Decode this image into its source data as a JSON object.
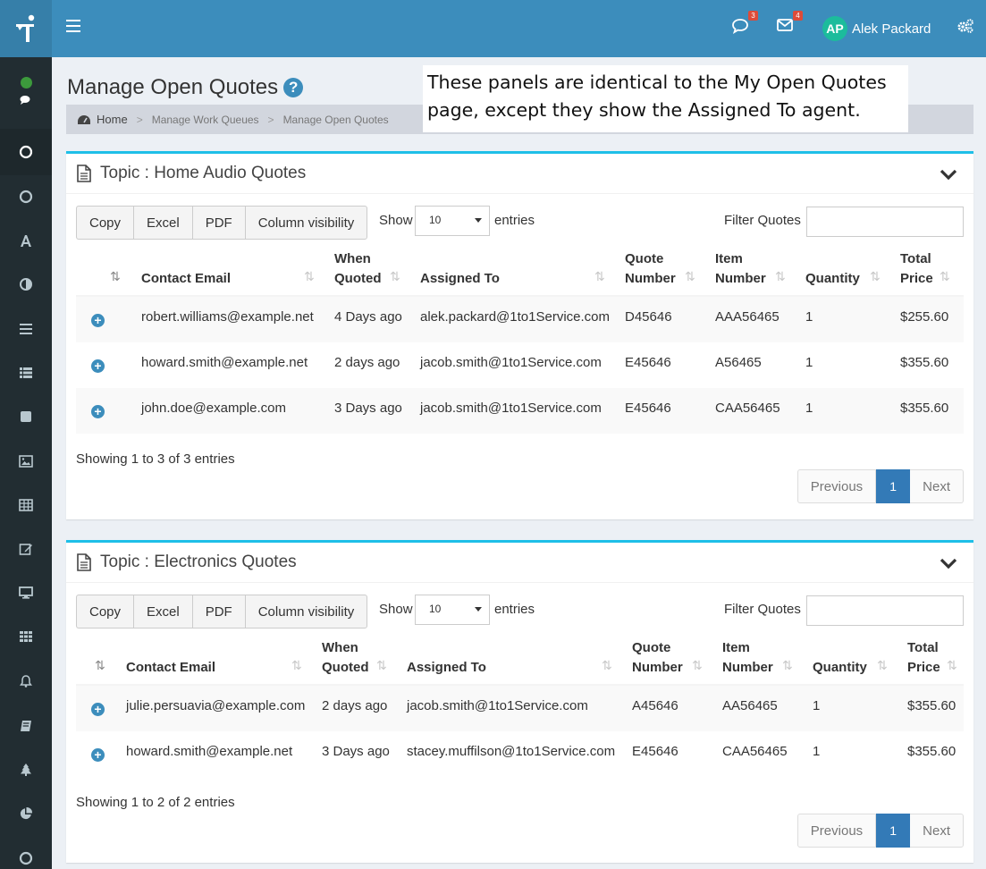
{
  "header": {
    "user_initials": "AP",
    "user_name": "Alek Packard",
    "chat_badge": "3",
    "mail_badge": "4"
  },
  "page": {
    "title": "Manage Open Quotes",
    "help": "?",
    "breadcrumb": [
      "Home",
      "Manage Work Queues",
      "Manage Open Quotes"
    ],
    "callout": [
      "These panels are identical to the My Open Quotes",
      "page, except they show the Assigned To agent."
    ]
  },
  "toolbar": {
    "copy": "Copy",
    "excel": "Excel",
    "pdf": "PDF",
    "column_visibility": "Column visibility",
    "show": "Show",
    "entries_value": "10",
    "entries": "entries",
    "filter": "Filter Quotes"
  },
  "columns": {
    "email": "Contact Email",
    "when1": "When",
    "when2": "Quoted",
    "assigned": "Assigned To",
    "quote1": "Quote",
    "quote2": "Number",
    "item1": "Item",
    "item2": "Number",
    "qty": "Quantity",
    "total1": "Total",
    "total2": "Price"
  },
  "pager": {
    "previous": "Previous",
    "page": "1",
    "next": "Next"
  },
  "panels": [
    {
      "title": "Topic : Home Audio Quotes",
      "info": "Showing 1 to 3 of 3 entries",
      "rows": [
        [
          "robert.williams@example.net",
          "4 Days ago",
          "alek.packard@1to1Service.com",
          "D45646",
          "AAA56465",
          "1",
          "$255.60"
        ],
        [
          "howard.smith@example.net",
          "2 days ago",
          "jacob.smith@1to1Service.com",
          "E45646",
          "A56465",
          "1",
          "$355.60"
        ],
        [
          "john.doe@example.com",
          "3 Days ago",
          "jacob.smith@1to1Service.com",
          "E45646",
          "CAA56465",
          "1",
          "$355.60"
        ]
      ]
    },
    {
      "title": "Topic : Electronics Quotes",
      "info": "Showing 1 to 2 of 2 entries",
      "rows": [
        [
          "julie.persuavia@example.com",
          "2 days ago",
          "jacob.smith@1to1Service.com",
          "A45646",
          "AA56465",
          "1",
          "$355.60"
        ],
        [
          "howard.smith@example.net",
          "3 Days ago",
          "stacey.muffilson@1to1Service.com",
          "E45646",
          "CAA56465",
          "1",
          "$355.60"
        ]
      ]
    }
  ]
}
